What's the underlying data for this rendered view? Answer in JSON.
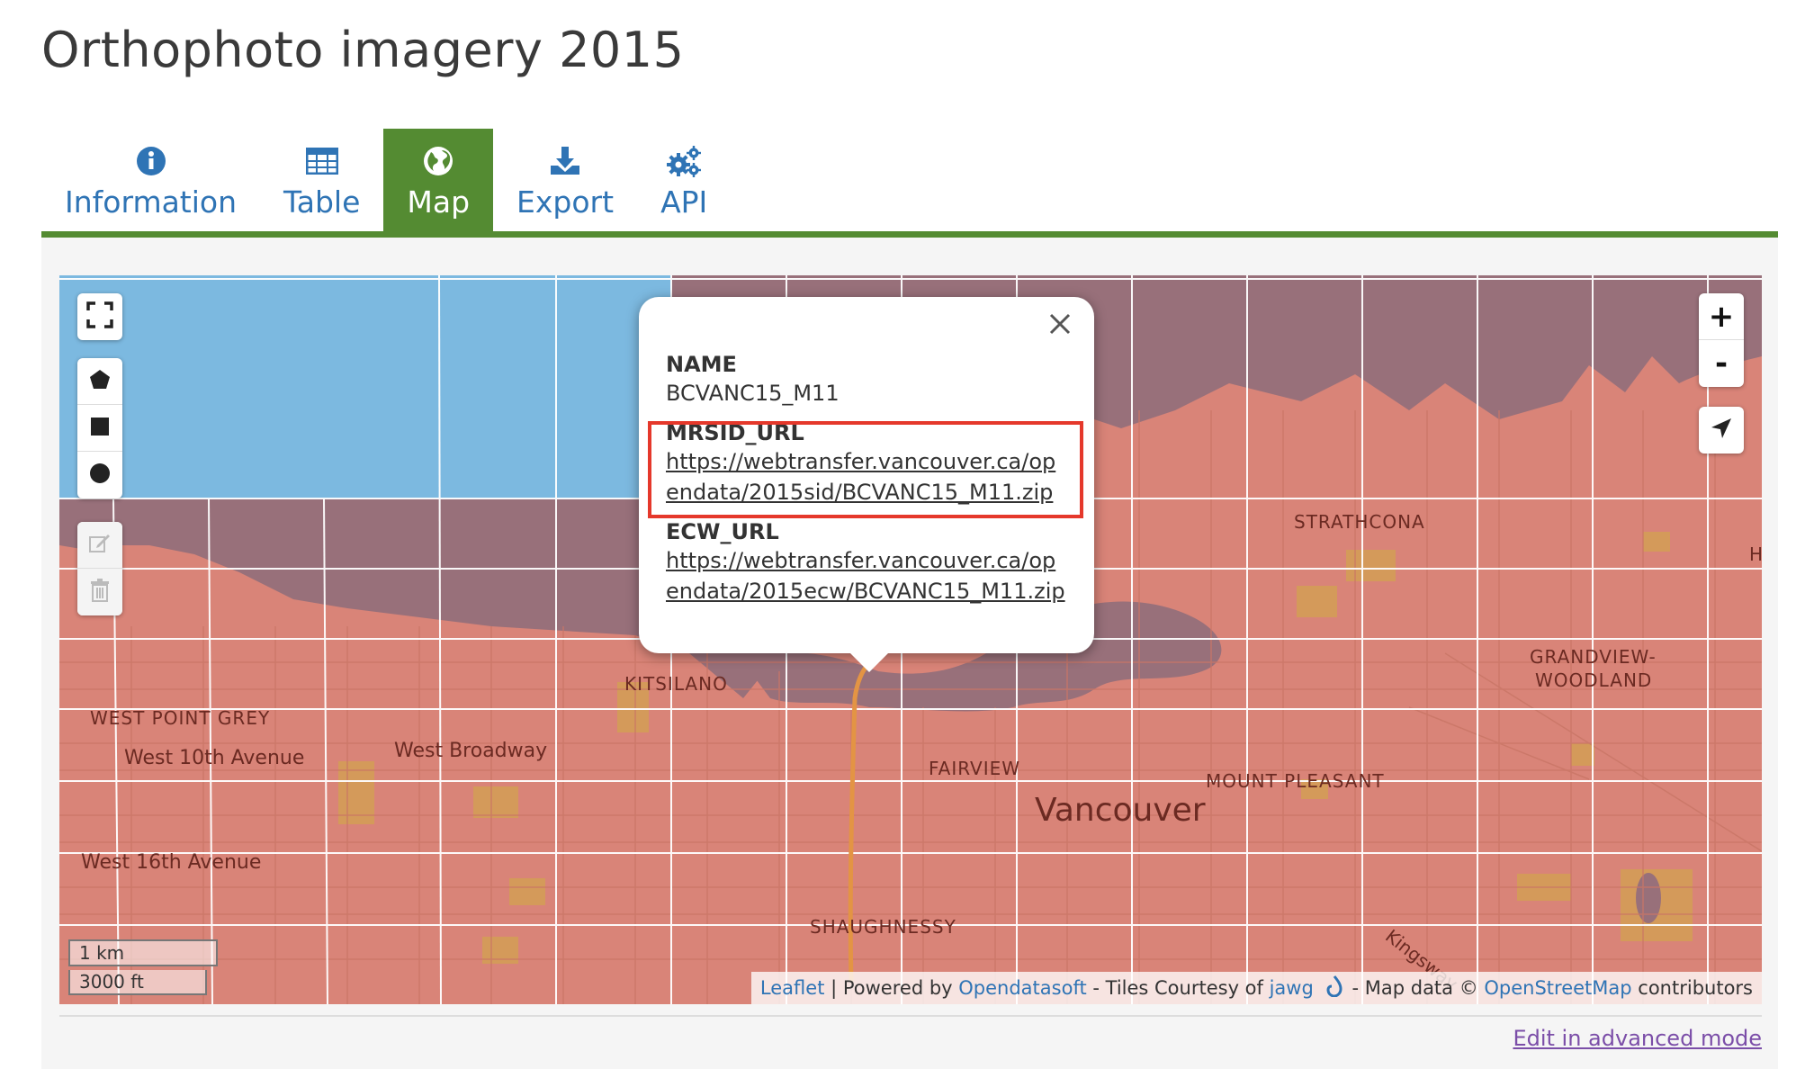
{
  "page": {
    "title": "Orthophoto imagery 2015"
  },
  "tabs": [
    {
      "label": "Information",
      "icon": "info-icon",
      "active": false
    },
    {
      "label": "Table",
      "icon": "table-icon",
      "active": false
    },
    {
      "label": "Map",
      "icon": "globe-icon",
      "active": true
    },
    {
      "label": "Export",
      "icon": "download-icon",
      "active": false
    },
    {
      "label": "API",
      "icon": "gears-icon",
      "active": false
    }
  ],
  "map": {
    "labels": {
      "strathcona": "STRATHCONA",
      "grandview": "GRANDVIEW-",
      "woodland": "WOODLAND",
      "kitsilano": "KITSILANO",
      "west_point_grey": "WEST POINT GREY",
      "west_10th": "West 10th Avenue",
      "west_broadway": "West Broadway",
      "fairview": "FAIRVIEW",
      "mount_pleasant": "MOUNT PLEASANT",
      "vancouver": "Vancouver",
      "west_16th": "West 16th Avenue",
      "shaughnessy": "SHAUGHNESSY",
      "kingsway": "Kingsway",
      "h_edge": "H"
    },
    "zoom_in": "+",
    "zoom_out": "-",
    "scale": {
      "metric": "1 km",
      "imperial": "3000 ft"
    },
    "attribution": {
      "leaflet": "Leaflet",
      "sep1": " | Powered by ",
      "ods": "Opendatasoft",
      "sep2": " - Tiles Courtesy of ",
      "jawg": "jawg",
      "sep3": " - Map data © ",
      "osm": "OpenStreetMap",
      "sep4": " contributors"
    }
  },
  "popup": {
    "name_label": "NAME",
    "name_value": "BCVANC15_M11",
    "mrsid_label": "MRSID_URL",
    "mrsid_url": "https://webtransfer.vancouver.ca/opendata/2015sid/BCVANC15_M11.zip",
    "ecw_label": "ECW_URL",
    "ecw_url": "https://webtransfer.vancouver.ca/opendata/2015ecw/BCVANC15_M11.zip"
  },
  "footer": {
    "edit_link": "Edit in advanced mode"
  },
  "colors": {
    "accent_green": "#548b32",
    "link_blue": "#2f74b5",
    "map_fill": "#d98478",
    "water_purple": "#98707a",
    "water_blue": "#7cb9e0",
    "highlight_red": "#e5382b"
  }
}
